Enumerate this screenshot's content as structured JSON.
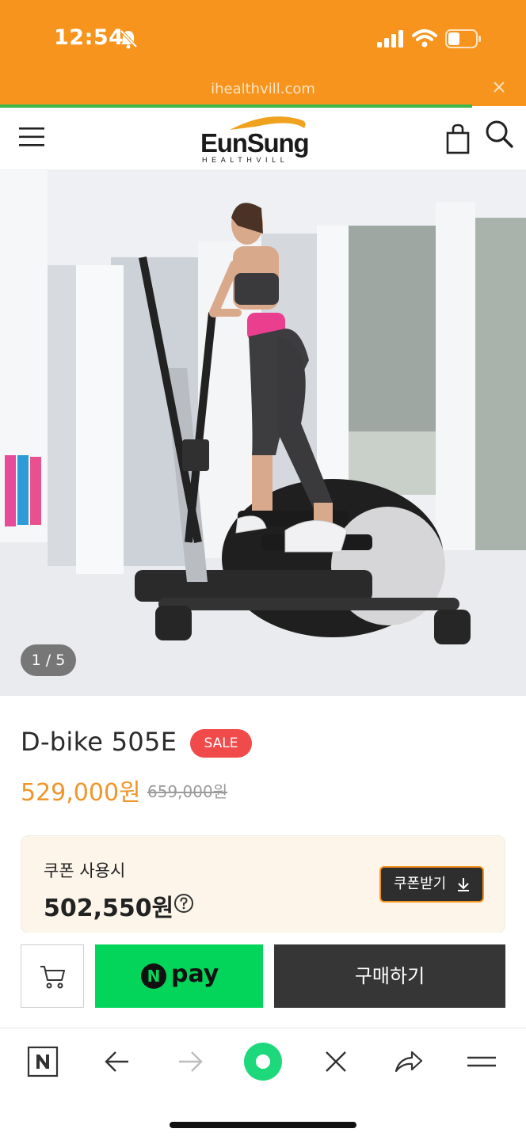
{
  "status_bar": {
    "time": "12:54",
    "icons": [
      "bell-slash-icon",
      "signal-icon",
      "wifi-icon",
      "battery-icon"
    ]
  },
  "browser": {
    "url": "ihealthvill.com",
    "progress_fraction": 0.9
  },
  "header": {
    "logo_text": "EunSung",
    "logo_subtext": "HEALTHVILL",
    "icons": [
      "menu-icon",
      "shopping-bag-icon",
      "search-icon"
    ]
  },
  "gallery": {
    "counter": "1 / 5"
  },
  "product": {
    "name": "D-bike 505E",
    "badge": "SALE",
    "price": "529,000원",
    "original_price": "659,000원"
  },
  "coupon": {
    "label": "쿠폰 사용시",
    "price": "502,550원",
    "button_label": "쿠폰받기"
  },
  "buy_bar": {
    "npay_logo": "N",
    "npay_label": "pay",
    "buy_label": "구매하기"
  },
  "colors": {
    "brand_orange": "#f7941d",
    "sale_red": "#f04a4a",
    "price_orange": "#f0952a",
    "npay_green": "#03d55a",
    "buy_dark": "#363636"
  },
  "bottom_nav": [
    "naver-icon",
    "back-icon",
    "forward-icon",
    "green-dot-icon",
    "close-icon",
    "share-icon",
    "menu-icon"
  ]
}
